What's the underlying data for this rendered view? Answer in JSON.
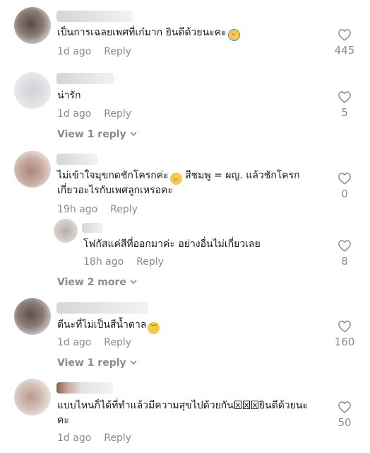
{
  "ui": {
    "reply_label": "Reply"
  },
  "comments": [
    {
      "text": "เป็นการเฉลยเพศที่เก๋มาก ยินดีด้วยนะคะ",
      "time": "1d ago",
      "likes": "445",
      "emoji": "sleeping-face"
    },
    {
      "text": "น่ารัก",
      "time": "1d ago",
      "likes": "5",
      "view_replies": "View 1 reply"
    },
    {
      "text_line1": "ไม่เข้าใจมุขกดชักโครกค่ะ",
      "text_line1_tail": " สีชมพู = ผญ. แล้วชักโครก",
      "text_line2": "เกี่ยวอะไรกับเพศลูกเหรอคะ",
      "time": "19h ago",
      "likes": "0",
      "emoji": "crying-face",
      "reply": {
        "text": "โฟกัสแค่สีที่ออกมาค่ะ อย่างอื่นไม่เกี่ยวเลย",
        "time": "18h ago",
        "likes": "8"
      },
      "view_replies": "View 2 more"
    },
    {
      "text": "ดีนะที่ไม่เป็นสีน้ำตาล",
      "time": "1d ago",
      "likes": "160",
      "emoji": "disappointed-face",
      "view_replies": "View 1 reply"
    },
    {
      "text_line1": "แบบไหนก็ได้ที่ทำแล้วมีความสุขไปด้วยกัน",
      "text_line1_tail": "ยินดีด้วยนะ",
      "text_line2": "คะ",
      "time": "1d ago",
      "likes": "50",
      "emoji": "missing-glyph-boxes"
    }
  ],
  "colors": {
    "text": "#161823",
    "muted": "#8a8b91",
    "background": "#ffffff"
  }
}
